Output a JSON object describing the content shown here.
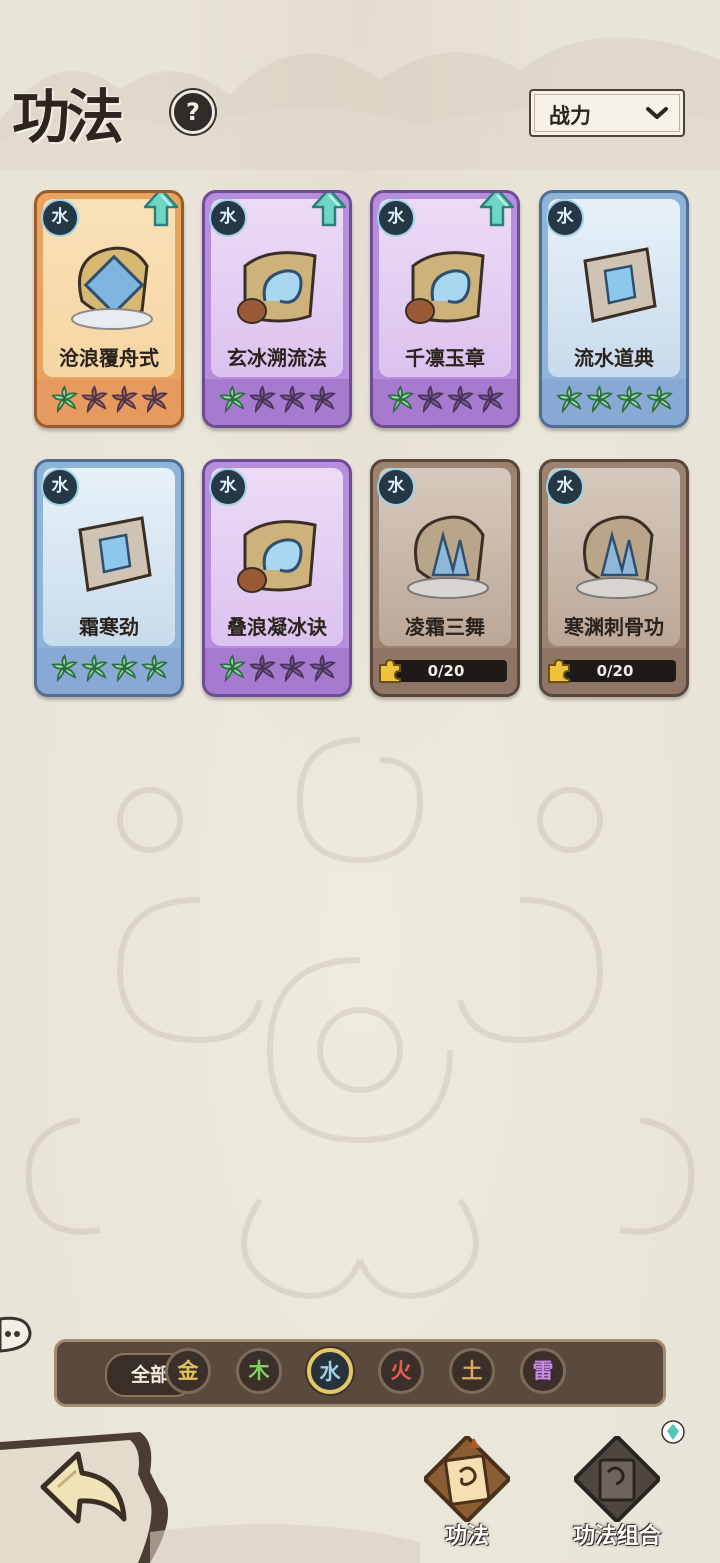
{
  "header": {
    "title": "功法",
    "help_icon": "question-icon"
  },
  "sort": {
    "selected": "战力"
  },
  "cards": [
    {
      "name": "沧浪覆舟式",
      "element": "水",
      "rarity": "orange",
      "stars_filled": 1,
      "stars_total": 4,
      "upgradable": true
    },
    {
      "name": "玄冰溯流法",
      "element": "水",
      "rarity": "purple",
      "stars_filled": 1,
      "stars_total": 4,
      "upgradable": true
    },
    {
      "name": "千凛玉章",
      "element": "水",
      "rarity": "purple",
      "stars_filled": 1,
      "stars_total": 4,
      "upgradable": true
    },
    {
      "name": "流水道典",
      "element": "水",
      "rarity": "blue",
      "stars_filled": 4,
      "stars_total": 4,
      "upgradable": false
    },
    {
      "name": "霜寒劲",
      "element": "水",
      "rarity": "blue",
      "stars_filled": 4,
      "stars_total": 4,
      "upgradable": false
    },
    {
      "name": "叠浪凝冰诀",
      "element": "水",
      "rarity": "purple",
      "stars_filled": 1,
      "stars_total": 4,
      "upgradable": false
    },
    {
      "name": "凌霜三舞",
      "element": "水",
      "rarity": "brown",
      "locked": true,
      "fragments": "0/20"
    },
    {
      "name": "寒渊刺骨功",
      "element": "水",
      "rarity": "brown",
      "locked": true,
      "fragments": "0/20"
    }
  ],
  "filters": {
    "all_label": "全部",
    "elements": [
      {
        "label": "金",
        "color": "#e0c25a"
      },
      {
        "label": "木",
        "color": "#7bd35c"
      },
      {
        "label": "水",
        "color": "#9fd2e6",
        "active": true
      },
      {
        "label": "火",
        "color": "#e5604f"
      },
      {
        "label": "土",
        "color": "#e2a85a"
      },
      {
        "label": "雷",
        "color": "#c78ae6"
      }
    ]
  },
  "nav": {
    "tabs": [
      {
        "label": "功法",
        "active": true
      },
      {
        "label": "功法组合",
        "active": false
      }
    ]
  }
}
